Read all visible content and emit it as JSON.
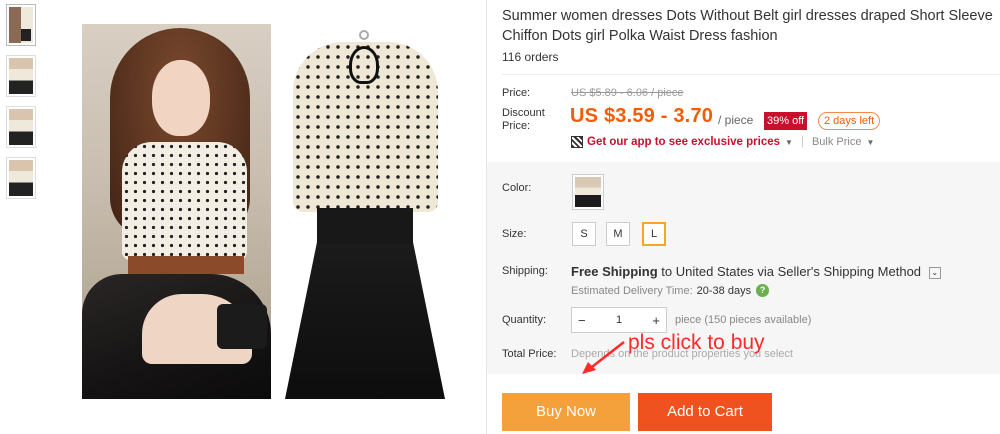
{
  "product": {
    "title": "Summer women dresses Dots Without Belt girl dresses draped Short Sleeve Chiffon Dots girl Polka Waist Dress fashion",
    "orders": "116 orders"
  },
  "thumbnails": [
    {
      "name": "thumb-1"
    },
    {
      "name": "thumb-2"
    },
    {
      "name": "thumb-3"
    },
    {
      "name": "thumb-4"
    }
  ],
  "price": {
    "label": "Price:",
    "original": "US $5.89 - 6.06 / piece",
    "discount_label_1": "Discount",
    "discount_label_2": "Price:",
    "discount_price": "US $3.59 - 3.70",
    "unit": "/ piece",
    "off_badge": "39% off",
    "days_left": "2 days left",
    "app_promo": "Get our app to see exclusive prices",
    "bulk": "Bulk Price"
  },
  "options": {
    "color_label": "Color:",
    "size_label": "Size:",
    "sizes": [
      "S",
      "M",
      "L"
    ],
    "selected_size": "L",
    "shipping_label": "Shipping:",
    "shipping_free": "Free Shipping",
    "shipping_rest": "to United States via Seller's Shipping Method",
    "delivery_label": "Estimated Delivery Time:",
    "delivery_days": "20-38 days",
    "quantity_label": "Quantity:",
    "quantity_value": "1",
    "pieces_available": "piece (150 pieces available)",
    "total_label": "Total Price:",
    "total_note": "Depends on the product properties you select"
  },
  "overlay_text": "pls click to buy",
  "buttons": {
    "buy_now": "Buy Now",
    "add_to_cart": "Add to Cart"
  },
  "colors": {
    "accent_orange": "#f25c05",
    "buy_now_bg": "#f5a13b",
    "add_to_cart_bg": "#f0521f",
    "discount_badge": "#c8102e",
    "overlay_red": "#ff2a2a"
  }
}
